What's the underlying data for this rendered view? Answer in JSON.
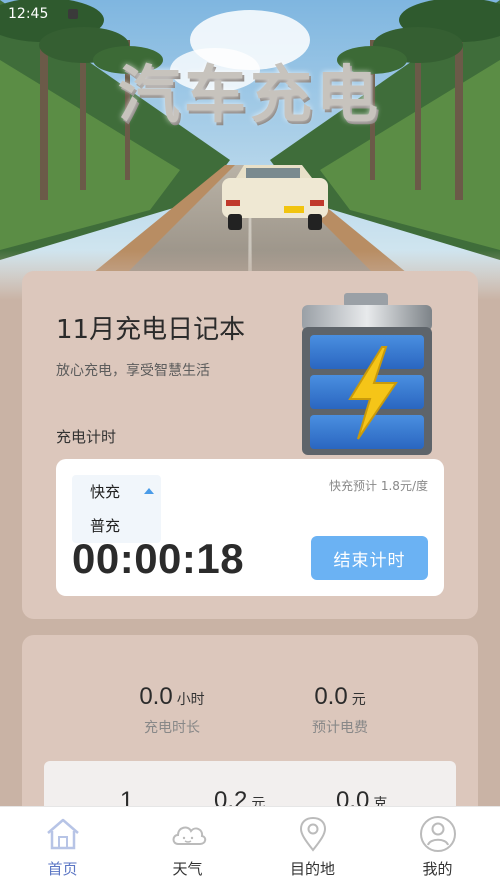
{
  "status": {
    "time": "12:45"
  },
  "hero": {
    "title": "汽车充电"
  },
  "card": {
    "title": "11月充电日记本",
    "subtitle": "放心充电，享受智慧生活",
    "timer_label": "充电计时"
  },
  "timer": {
    "mode_options": [
      "快充",
      "普充"
    ],
    "selected_mode": "快充",
    "rate_text": "快充预计 1.8元/度",
    "elapsed": "00:00:18",
    "end_button": "结束计时"
  },
  "stats": {
    "duration": {
      "value": "0.0",
      "unit": "小时",
      "label": "充电时长"
    },
    "cost": {
      "value": "0.0",
      "unit": "元",
      "label": "预计电费"
    },
    "inner": [
      {
        "value": "1",
        "unit": ""
      },
      {
        "value": "0.2",
        "unit": "元"
      },
      {
        "value": "0.0",
        "unit": "克"
      }
    ]
  },
  "tabs": [
    {
      "label": "首页",
      "icon": "home-icon",
      "active": true
    },
    {
      "label": "天气",
      "icon": "cloud-icon",
      "active": false
    },
    {
      "label": "目的地",
      "icon": "location-pin-icon",
      "active": false
    },
    {
      "label": "我的",
      "icon": "user-icon",
      "active": false
    }
  ],
  "colors": {
    "accent": "#6bb2f3",
    "tab_active": "#5b76c4",
    "card_bg": "#dcc7bc",
    "page_bg": "#c9b3a5"
  }
}
